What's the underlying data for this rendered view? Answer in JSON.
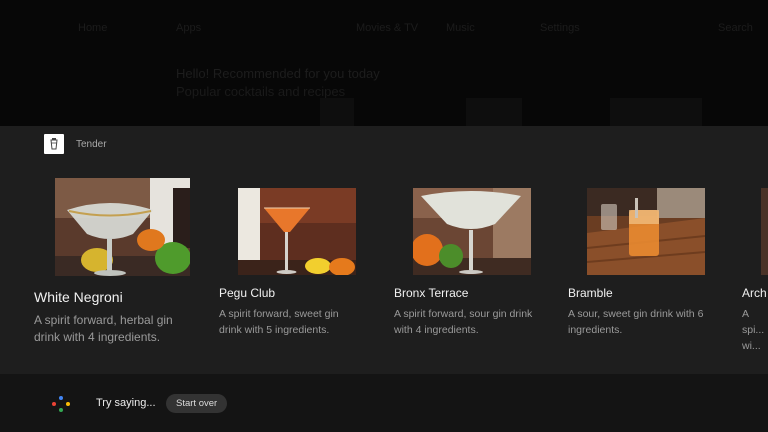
{
  "background_app": {
    "nav": [
      "Home",
      "Apps",
      "Movies & TV",
      "Music",
      "Settings",
      "Search"
    ],
    "title": "Hello! Recommended for you today",
    "subtitle": "Popular cocktails and recipes"
  },
  "app": {
    "name": "Tender",
    "icon": "cocktail-shaker-icon"
  },
  "cards": [
    {
      "title": "White Negroni",
      "description": "A spirit forward, herbal gin drink with 4 ingredients.",
      "image": "white-negroni-photo",
      "selected": true
    },
    {
      "title": "Pegu Club",
      "description": "A spirit forward, sweet gin drink with 5 ingredients.",
      "image": "pegu-club-photo",
      "selected": false
    },
    {
      "title": "Bronx Terrace",
      "description": "A spirit forward, sour gin drink with 4 ingredients.",
      "image": "bronx-terrace-photo",
      "selected": false
    },
    {
      "title": "Bramble",
      "description": "A sour, sweet gin drink with 6 ingredients.",
      "image": "bramble-photo",
      "selected": false
    },
    {
      "title": "Arch",
      "description": "A spi... wi...",
      "image": "arch-photo",
      "selected": false
    }
  ],
  "assistant": {
    "icon": "google-assistant-dots-icon",
    "prompt": "Try saying...",
    "suggestion": "Start over"
  },
  "colors": {
    "panel": "#1e1e1e",
    "assistant_bar": "#141414",
    "dot_blue": "#4285F4",
    "dot_red": "#EA4335",
    "dot_yellow": "#FBBC05",
    "dot_green": "#34A853"
  }
}
